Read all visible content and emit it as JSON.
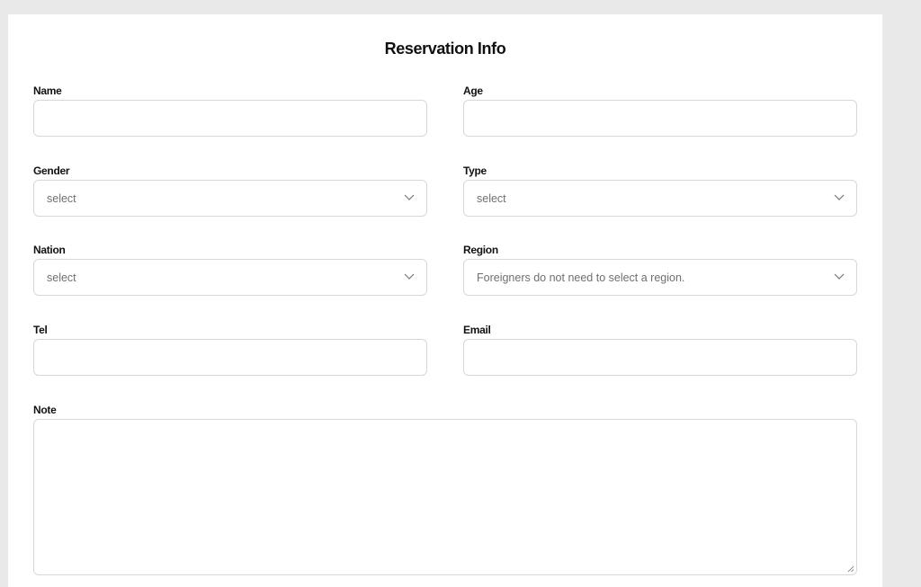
{
  "form": {
    "title": "Reservation Info",
    "name": {
      "label": "Name",
      "value": ""
    },
    "age": {
      "label": "Age",
      "value": ""
    },
    "gender": {
      "label": "Gender",
      "selected": "select"
    },
    "type": {
      "label": "Type",
      "selected": "select"
    },
    "nation": {
      "label": "Nation",
      "selected": "select"
    },
    "region": {
      "label": "Region",
      "selected": "Foreigners do not need to select a region."
    },
    "tel": {
      "label": "Tel",
      "value": ""
    },
    "email": {
      "label": "Email",
      "value": ""
    },
    "note": {
      "label": "Note",
      "value": ""
    }
  },
  "icons": {
    "dropdown": "chevron-down-icon",
    "resize": "resize-grip-icon"
  },
  "colors": {
    "page_bg": "#e9e9e9",
    "panel_bg": "#ffffff",
    "border": "#d7d7d7",
    "placeholder_text": "#6f6f6f"
  }
}
